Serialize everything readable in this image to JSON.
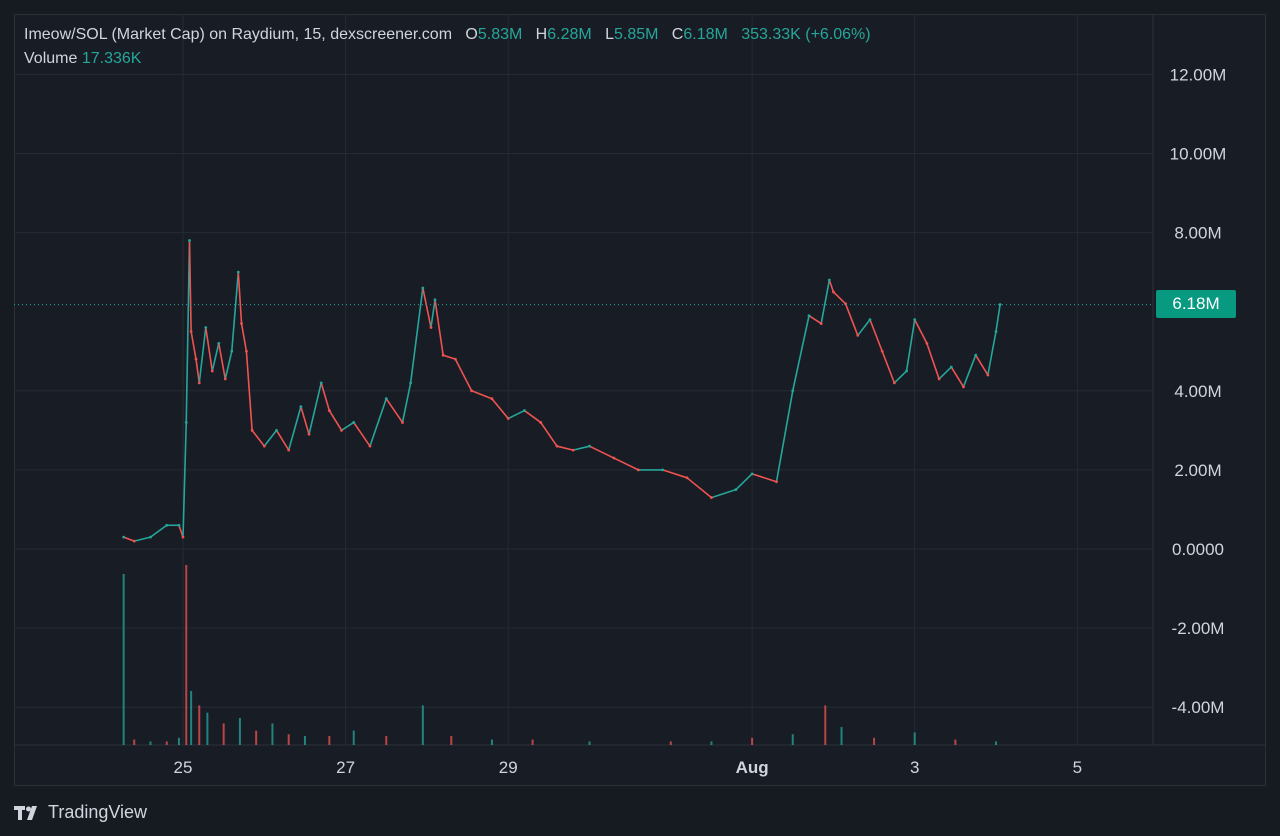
{
  "legend": {
    "title": "Imeow/SOL (Market Cap) on Raydium, 15, dexscreener.com",
    "o_label": "O",
    "o_value": "5.83M",
    "h_label": "H",
    "h_value": "6.28M",
    "l_label": "L",
    "l_value": "5.85M",
    "c_label": "C",
    "c_value": "6.18M",
    "change": "353.33K (+6.06%)",
    "volume_label": "Volume",
    "volume_value": "17.336K"
  },
  "last_price_label": "6.18M",
  "footer": {
    "brand": "TradingView"
  },
  "colors": {
    "up": "#26a69a",
    "down": "#ef5350",
    "background": "#181c25",
    "grid": "#262a33",
    "text": "#d1d4dc",
    "badge": "#089981"
  },
  "chart_data": {
    "type": "line",
    "title": "Imeow/SOL (Market Cap) on Raydium, 15, dexscreener.com",
    "xlabel": "",
    "ylabel": "",
    "x_ticks": [
      "25",
      "27",
      "29",
      "Aug",
      "3",
      "5"
    ],
    "x_tick_days": [
      25,
      27,
      29,
      32,
      34,
      36
    ],
    "y_ticks": [
      "12.00M",
      "10.00M",
      "8.00M",
      "4.00M",
      "2.00M",
      "0.0000",
      "-2.00M",
      "-4.00M"
    ],
    "y_tick_values": [
      12000000,
      10000000,
      8000000,
      4000000,
      2000000,
      0,
      -2000000,
      -4000000
    ],
    "ylim": [
      -4900000,
      12700000
    ],
    "xlim": [
      23.0,
      38.0
    ],
    "grid": true,
    "last_price": 6180000,
    "series": [
      {
        "name": "Market Cap",
        "x": [
          24.27,
          24.4,
          24.6,
          24.8,
          24.95,
          25.0,
          25.04,
          25.08,
          25.1,
          25.16,
          25.2,
          25.28,
          25.36,
          25.44,
          25.52,
          25.6,
          25.68,
          25.72,
          25.78,
          25.85,
          26.0,
          26.15,
          26.3,
          26.45,
          26.55,
          26.7,
          26.8,
          26.95,
          27.1,
          27.3,
          27.5,
          27.7,
          27.8,
          27.95,
          28.05,
          28.1,
          28.2,
          28.35,
          28.55,
          28.8,
          29.0,
          29.2,
          29.4,
          29.6,
          29.8,
          30.0,
          30.3,
          30.6,
          30.9,
          31.2,
          31.5,
          31.8,
          32.0,
          32.3,
          32.5,
          32.7,
          32.85,
          32.95,
          33.0,
          33.15,
          33.3,
          33.45,
          33.6,
          33.75,
          33.9,
          34.0,
          34.15,
          34.3,
          34.45,
          34.6,
          34.75,
          34.9,
          35.0,
          35.05
        ],
        "values": [
          300000,
          200000,
          300000,
          600000,
          600000,
          300000,
          3200000,
          7800000,
          5500000,
          4800000,
          4200000,
          5600000,
          4500000,
          5200000,
          4300000,
          5000000,
          7000000,
          5700000,
          5000000,
          3000000,
          2600000,
          3000000,
          2500000,
          3600000,
          2900000,
          4200000,
          3500000,
          3000000,
          3200000,
          2600000,
          3800000,
          3200000,
          4200000,
          6600000,
          5600000,
          6300000,
          4900000,
          4800000,
          4000000,
          3800000,
          3300000,
          3500000,
          3200000,
          2600000,
          2500000,
          2600000,
          2300000,
          2000000,
          2000000,
          1800000,
          1300000,
          1500000,
          1900000,
          1700000,
          4000000,
          5900000,
          5700000,
          6800000,
          6500000,
          6200000,
          5400000,
          5800000,
          5000000,
          4200000,
          4500000,
          5800000,
          5200000,
          4300000,
          4600000,
          4100000,
          4900000,
          4400000,
          5500000,
          6180000
        ]
      },
      {
        "name": "Volume",
        "x": [
          24.27,
          24.4,
          24.6,
          24.8,
          24.95,
          25.04,
          25.1,
          25.2,
          25.3,
          25.5,
          25.7,
          25.9,
          26.1,
          26.3,
          26.5,
          26.8,
          27.1,
          27.5,
          27.95,
          28.3,
          28.8,
          29.3,
          30.0,
          31.0,
          31.5,
          32.0,
          32.5,
          32.9,
          33.1,
          33.5,
          34.0,
          34.5,
          35.0
        ],
        "values": [
          0.95,
          0.03,
          0.02,
          0.02,
          0.04,
          1.0,
          0.3,
          0.22,
          0.18,
          0.12,
          0.15,
          0.08,
          0.12,
          0.06,
          0.05,
          0.05,
          0.08,
          0.05,
          0.22,
          0.05,
          0.03,
          0.03,
          0.02,
          0.02,
          0.02,
          0.04,
          0.06,
          0.22,
          0.1,
          0.04,
          0.07,
          0.03,
          0.02
        ]
      }
    ]
  }
}
